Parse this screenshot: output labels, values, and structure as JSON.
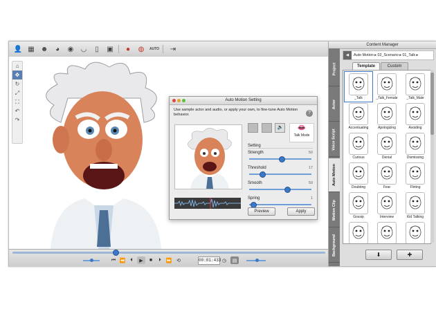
{
  "toolbar": {
    "items": [
      "actor-icon",
      "scene-icon",
      "head-icon",
      "face-icon",
      "eye-icon",
      "mouth-icon",
      "body-icon",
      "image-icon",
      "audio-record-icon",
      "motion-record-icon",
      "auto-icon",
      "export-icon"
    ],
    "auto_label": "AUTO"
  },
  "left_tools": [
    "home-icon",
    "move-icon",
    "rotate-icon",
    "scale-icon",
    "fit-icon",
    "undo-icon",
    "redo-icon"
  ],
  "timeline": {
    "time": "00:01:433",
    "position": 0.33
  },
  "dialog": {
    "title": "Auto Motion Setting",
    "hint": "Use sample actor and audio, or apply your own, to fine-tune Auto Motion behavior.",
    "help": "?",
    "talk_mode": "Talk Mode",
    "setting_label": "Setting",
    "sliders": [
      {
        "label": "Strength",
        "value": "50",
        "level": 0.5
      },
      {
        "label": "Threshold",
        "value": "17",
        "level": 0.17
      },
      {
        "label": "Smooth",
        "value": "59",
        "level": 0.59
      },
      {
        "label": "Spring",
        "value": "1",
        "level": 0.02
      }
    ],
    "preview_btn": "Preview",
    "apply_btn": "Apply"
  },
  "content_manager": {
    "title": "Content Manager",
    "breadcrumb": "Auto Motion ▸ 02_Scenario ▸ 01_Talk ▸",
    "back": "◀",
    "tabs": [
      "Template",
      "Custom"
    ],
    "side_tabs": [
      "Project",
      "Actor",
      "Voice Script",
      "Auto Motion",
      "Motion Clip",
      "Background"
    ],
    "items": [
      "_Talk",
      "_Talk_Female",
      "_Talk_Male",
      "Accentuating",
      "Apologizing",
      "Avoiding",
      "Curious",
      "Denial",
      "Dismissing",
      "Doubting",
      "Fear",
      "Flirting",
      "Gossip",
      "Interview",
      "Kid Talking",
      "",
      "",
      ""
    ],
    "down_btn": "⬇",
    "add_btn": "✚"
  }
}
